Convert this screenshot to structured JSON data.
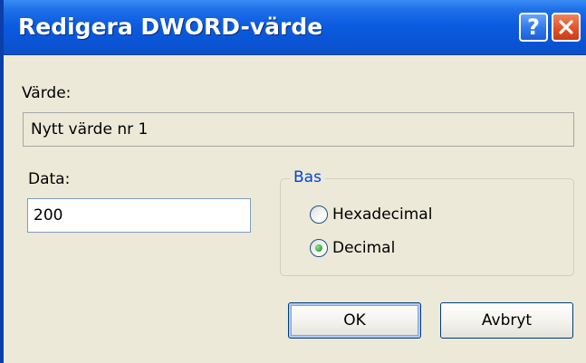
{
  "window": {
    "title": "Redigera DWORD-värde",
    "help_button_label": "?",
    "colors": {
      "title_bar": "#0b5ce0",
      "close_button": "#e0532a",
      "group_title": "#0046d5",
      "radio_selected": "#3fb03f"
    },
    "icons": {
      "help": "question-mark-icon",
      "close": "close-x-icon"
    }
  },
  "value": {
    "label": "Värde:",
    "text": "Nytt värde nr 1"
  },
  "data": {
    "label": "Data:",
    "value": "200"
  },
  "base": {
    "title": "Bas",
    "options": [
      {
        "label": "Hexadecimal",
        "selected": false
      },
      {
        "label": "Decimal",
        "selected": true
      }
    ]
  },
  "buttons": {
    "ok": "OK",
    "cancel": "Avbryt"
  }
}
